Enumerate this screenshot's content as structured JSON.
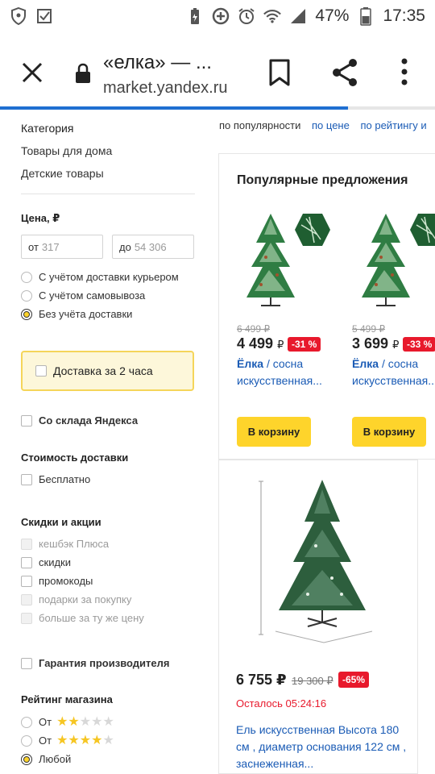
{
  "status_bar": {
    "battery_percent": "47%",
    "time": "17:35",
    "icons_left": [
      "shield-icon",
      "checkbox-icon"
    ],
    "icons_right": [
      "battery-saver-icon",
      "data-saver-icon",
      "alarm-icon",
      "wifi-icon",
      "signal-icon",
      "battery-icon"
    ]
  },
  "toolbar": {
    "title": "«елка» — ...",
    "url": "market.yandex.ru",
    "progress": 0.8
  },
  "sort": {
    "items": [
      "по популярности",
      "по цене",
      "по рейтингу и"
    ]
  },
  "filters": {
    "category_header": "Категория",
    "categories": [
      "Товары для дома",
      "Детские товары"
    ],
    "price_header": "Цена, ₽",
    "price_from_label": "от",
    "price_from_placeholder": "317",
    "price_to_label": "до",
    "price_to_placeholder": "54 306",
    "delivery_options": [
      "С учётом доставки курьером",
      "С учётом самовывоза",
      "Без учёта доставки"
    ],
    "delivery_selected": 2,
    "fast_delivery": "Доставка за 2 часа",
    "yandex_warehouse": "Со склада Яндекса",
    "delivery_cost_header": "Стоимость доставки",
    "free": "Бесплатно",
    "discounts_header": "Скидки и акции",
    "discounts": [
      {
        "label": "кешбэк Плюса",
        "disabled": true
      },
      {
        "label": "скидки",
        "disabled": false
      },
      {
        "label": "промокоды",
        "disabled": false
      },
      {
        "label": "подарки за покупку",
        "disabled": true
      },
      {
        "label": "больше за ту же цену",
        "disabled": true
      }
    ],
    "warranty": "Гарантия производителя",
    "rating_header": "Рейтинг магазина",
    "ratings": [
      {
        "label": "От",
        "stars": 2
      },
      {
        "label": "От",
        "stars": 4
      },
      {
        "label": "Любой",
        "stars": 0
      }
    ],
    "rating_selected": 2
  },
  "popular": {
    "title": "Популярные предложения",
    "offers": [
      {
        "old_price": "6 499 ₽",
        "price": "4 499",
        "currency": "₽",
        "discount": "-31 %",
        "name_bold": "Ёлка",
        "name_rest": " / сосна искусственная...",
        "button": "В корзину"
      },
      {
        "old_price": "5 499 ₽",
        "price": "3 699",
        "currency": "₽",
        "discount": "-33 %",
        "name_bold": "Ёлка",
        "name_rest": " / сосна искусственная...",
        "button": "В корзину"
      }
    ]
  },
  "card": {
    "price": "6 755 ₽",
    "old_price": "19 300 ₽",
    "discount": "-65%",
    "timer": "Осталось 05:24:16",
    "name": "Ель искусственная Высота 180 см , диаметр основания 122 см , заснеженная..."
  },
  "colors": {
    "accent_yellow": "#fed42b",
    "link_blue": "#1a5bb5",
    "discount_red": "#e8192c",
    "progress_blue": "#1f6fd1"
  }
}
